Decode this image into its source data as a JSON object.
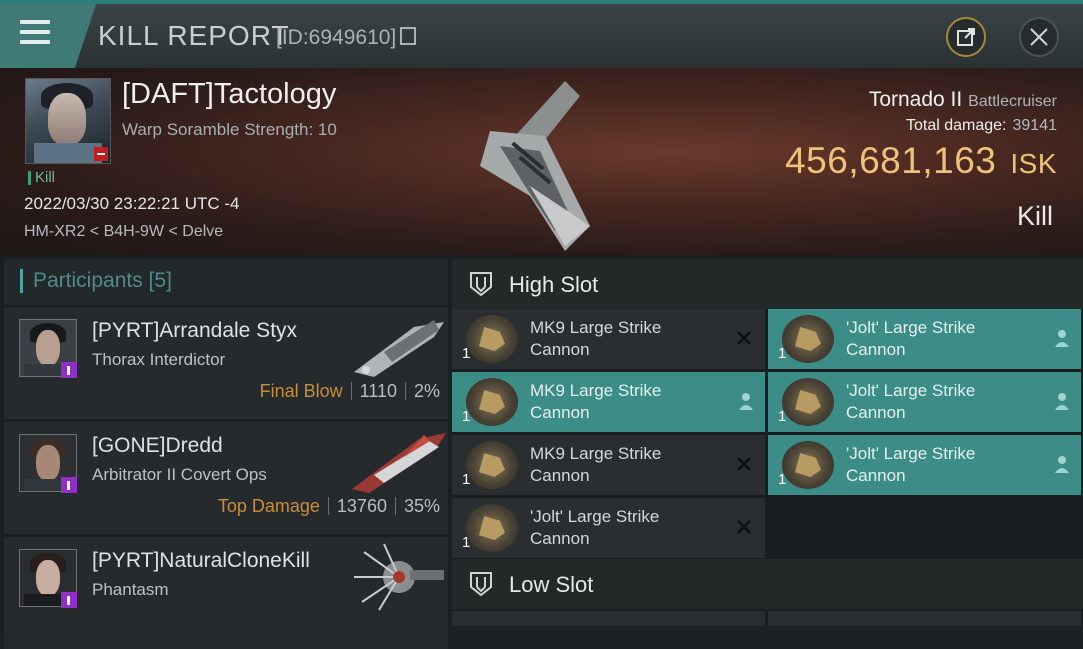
{
  "header": {
    "title": "KILL REPORT",
    "kill_id": "[ID:6949610]"
  },
  "victim": {
    "name": "[DAFT]Tactology",
    "subtitle": "Warp Soramble Strength: 10",
    "kill_tag": "Kill",
    "timestamp": "2022/03/30 23:22:21 UTC -4",
    "location": "HM-XR2 < B4H-9W < Delve",
    "ship_name": "Tornado II",
    "ship_class": "Battlecruiser",
    "total_damage_label": "Total damage:",
    "total_damage_value": "39141",
    "isk_value": "456,681,163",
    "isk_unit": "ISK",
    "result": "Kill"
  },
  "participants": {
    "header": "Participants [5]",
    "items": [
      {
        "name": "[PYRT]Arrandale Styx",
        "ship": "Thorax Interdictor",
        "tag": "Final Blow",
        "damage": "1110",
        "percent": "2%"
      },
      {
        "name": "[GONE]Dredd",
        "ship": "Arbitrator II Covert Ops",
        "tag": "Top Damage",
        "damage": "13760",
        "percent": "35%"
      },
      {
        "name": "[PYRT]NaturalCloneKill",
        "ship": "Phantasm"
      }
    ]
  },
  "slots": {
    "high_slot_label": "High Slot",
    "low_slot_label": "Low Slot",
    "high_items": [
      {
        "qty": "1",
        "name": "MK9 Large Strike Cannon",
        "highlighted": false,
        "status": "destroyed"
      },
      {
        "qty": "1",
        "name": "'Jolt' Large Strike Cannon",
        "highlighted": true,
        "status": "dropped"
      },
      {
        "qty": "1",
        "name": "MK9 Large Strike Cannon",
        "highlighted": true,
        "status": "dropped"
      },
      {
        "qty": "1",
        "name": "'Jolt' Large Strike Cannon",
        "highlighted": true,
        "status": "dropped"
      },
      {
        "qty": "1",
        "name": "MK9 Large Strike Cannon",
        "highlighted": false,
        "status": "destroyed"
      },
      {
        "qty": "1",
        "name": "'Jolt' Large Strike Cannon",
        "highlighted": true,
        "status": "dropped"
      },
      {
        "qty": "1",
        "name": "'Jolt' Large Strike Cannon",
        "highlighted": false,
        "status": "destroyed"
      }
    ]
  },
  "icons": {
    "menu": "hamburger-menu-icon",
    "copy": "copy-icon",
    "external": "external-link-icon",
    "close": "close-icon",
    "slot": "shield-slot-icon",
    "destroyed": "x-icon",
    "dropped": "person-icon"
  },
  "colors": {
    "accent_teal": "#3c8c87",
    "isk_gold": "#f0c17a",
    "final_blow_orange": "#c98e3a",
    "corp_badge_purple": "#8f2fc6",
    "red_badge": "#c21e1e"
  }
}
